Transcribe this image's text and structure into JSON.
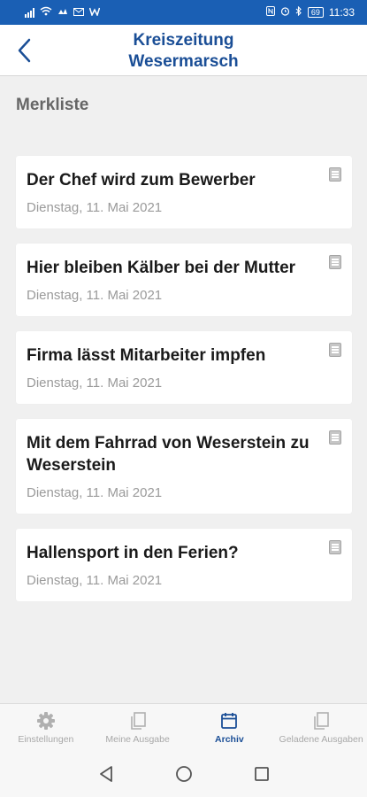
{
  "statusbar": {
    "time": "11:33",
    "battery": "69"
  },
  "header": {
    "title_line1": "Kreiszeitung",
    "title_line2": "Wesermarsch"
  },
  "section_title": "Merkliste",
  "articles": [
    {
      "title": "Der Chef wird zum Bewerber",
      "date": "Dienstag, 11. Mai 2021"
    },
    {
      "title": "Hier bleiben Kälber bei der Mutter",
      "date": "Dienstag, 11. Mai 2021"
    },
    {
      "title": "Firma lässt Mitarbeiter impfen",
      "date": "Dienstag, 11. Mai 2021"
    },
    {
      "title": "Mit dem Fahrrad von Weserstein zu Weserstein",
      "date": "Dienstag, 11. Mai 2021"
    },
    {
      "title": "Hallensport in den Ferien?",
      "date": "Dienstag, 11. Mai 2021"
    }
  ],
  "nav": [
    {
      "label": "Einstellungen",
      "icon": "gear-icon"
    },
    {
      "label": "Meine Ausgabe",
      "icon": "pages-icon"
    },
    {
      "label": "Archiv",
      "icon": "calendar-icon"
    },
    {
      "label": "Geladene Ausgaben",
      "icon": "pages-icon"
    }
  ],
  "colors": {
    "brand": "#1a4e96",
    "statusbar": "#1a5fb4",
    "inactive": "#a8a8a8"
  }
}
